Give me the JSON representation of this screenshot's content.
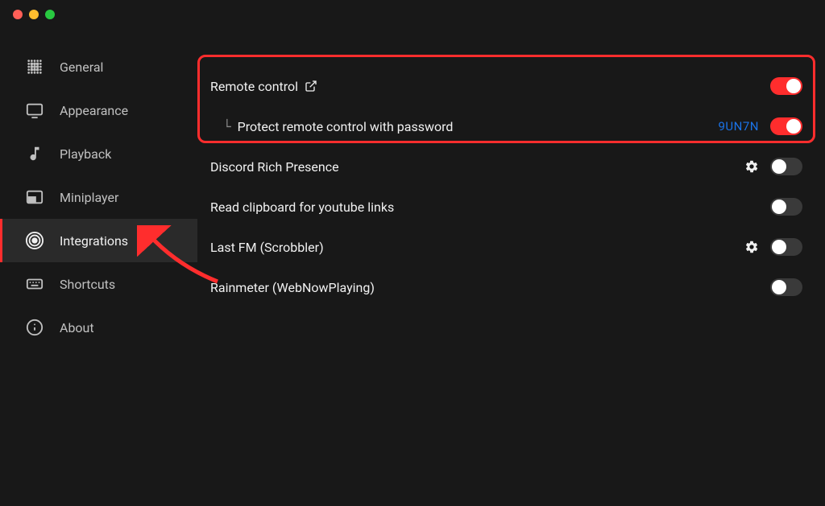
{
  "colors": {
    "accent": "#ff2d2d",
    "link": "#1a73e8"
  },
  "sidebar": {
    "items": [
      {
        "id": "general",
        "label": "General",
        "active": false
      },
      {
        "id": "appearance",
        "label": "Appearance",
        "active": false
      },
      {
        "id": "playback",
        "label": "Playback",
        "active": false
      },
      {
        "id": "miniplayer",
        "label": "Miniplayer",
        "active": false
      },
      {
        "id": "integrations",
        "label": "Integrations",
        "active": true
      },
      {
        "id": "shortcuts",
        "label": "Shortcuts",
        "active": false
      },
      {
        "id": "about",
        "label": "About",
        "active": false
      }
    ]
  },
  "settings": {
    "remote_control": {
      "label": "Remote control",
      "has_external_link": true,
      "enabled": true
    },
    "remote_password": {
      "label": "Protect remote control with password",
      "code": "9UN7N",
      "enabled": true
    },
    "discord": {
      "label": "Discord Rich Presence",
      "has_gear": true,
      "enabled": false
    },
    "clipboard": {
      "label": "Read clipboard for youtube links",
      "enabled": false
    },
    "lastfm": {
      "label": "Last FM (Scrobbler)",
      "has_gear": true,
      "enabled": false
    },
    "rainmeter": {
      "label": "Rainmeter (WebNowPlaying)",
      "enabled": false
    }
  }
}
